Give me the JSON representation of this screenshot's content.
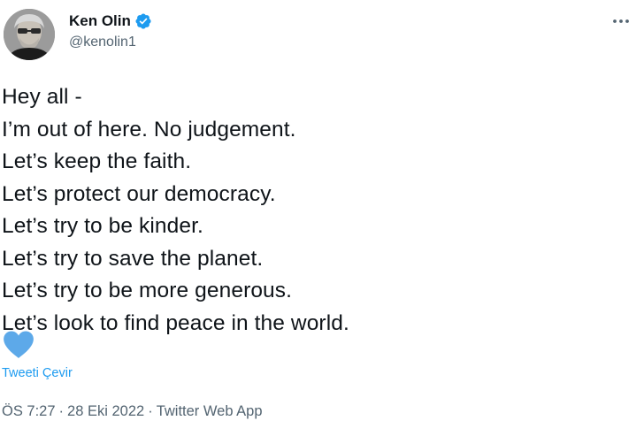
{
  "author": {
    "display_name": "Ken Olin",
    "handle": "@kenolin1"
  },
  "tweet": {
    "lines": [
      "Hey all -",
      "I’m out of here. No judgement.",
      "Let’s keep the faith.",
      "Let’s protect our democracy.",
      "Let’s try to be kinder.",
      "Let’s try to save the planet.",
      "Let’s try to be more generous.",
      "Let’s look to find peace in the world."
    ],
    "emoji": "blue-heart-icon",
    "translate_label": "Tweeti Çevir"
  },
  "meta": {
    "time": "ÖS 7:27",
    "date": "28 Eki 2022",
    "source": "Twitter Web App",
    "separator": "·"
  },
  "colors": {
    "verified": "#1d9bf0",
    "link": "#1d9bf0",
    "heart": "#5da9e9",
    "secondary_text": "#536471",
    "primary_text": "#0f1419"
  }
}
